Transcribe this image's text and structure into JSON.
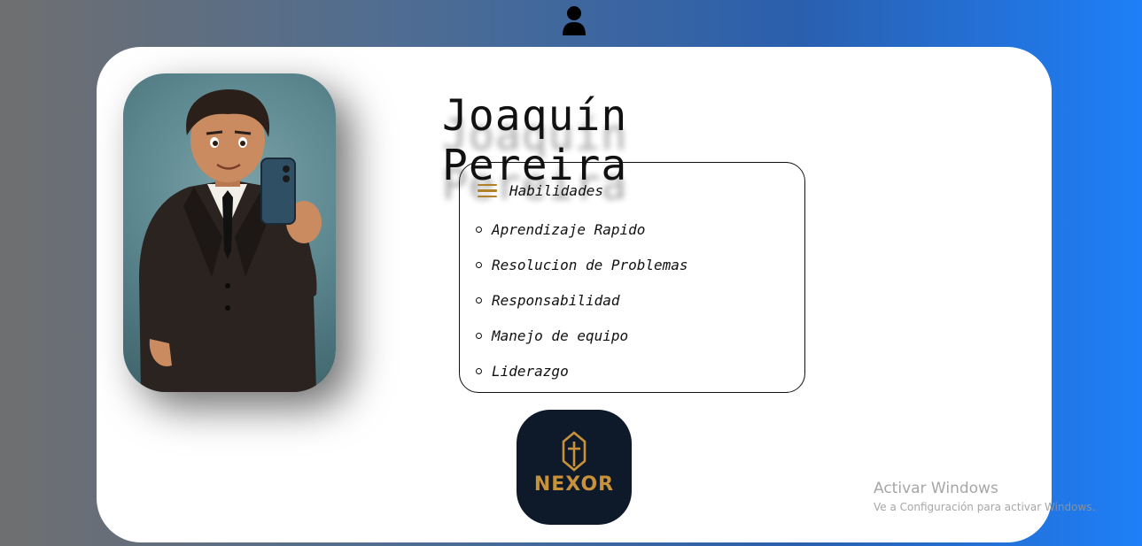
{
  "profile": {
    "name": "Joaquín Pereira",
    "photo_icon": "selfie-avatar-image",
    "user_icon": "user-icon"
  },
  "skills": {
    "title": "Habilidades",
    "menu_icon": "hamburger-menu-icon",
    "items": [
      "Aprendizaje Rapido",
      "Resolucion de Problemas",
      "Responsabilidad",
      "Manejo de equipo",
      "Liderazgo"
    ]
  },
  "logo": {
    "text": "NEXOR",
    "icon": "shield-cross-icon"
  },
  "watermark": {
    "title": "Activar Windows",
    "subtitle": "Ve a Configuración para activar Windows."
  },
  "colors": {
    "accent": "#b3802a",
    "logo_bg": "#0e1a2a",
    "logo_gold": "#c8923a"
  }
}
